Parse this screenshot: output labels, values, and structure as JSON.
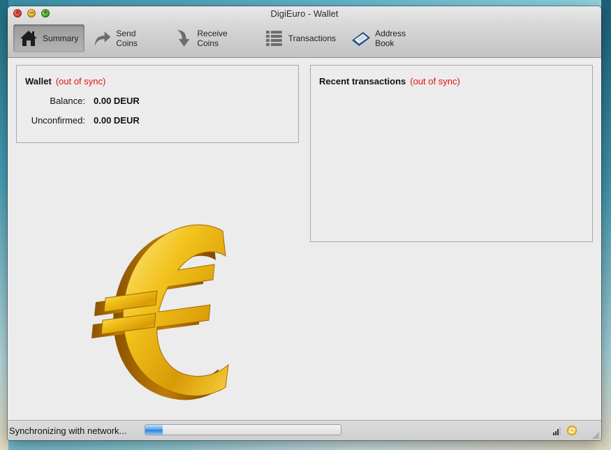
{
  "window": {
    "title": "DigiEuro - Wallet"
  },
  "toolbar": {
    "items": [
      {
        "label": "Summary",
        "icon": "home-icon",
        "active": true
      },
      {
        "label": "Send Coins",
        "icon": "send-arrow-icon"
      },
      {
        "label": "Receive Coins",
        "icon": "receive-arrow-icon"
      },
      {
        "label": "Transactions",
        "icon": "list-icon"
      },
      {
        "label": "Address Book",
        "icon": "address-book-icon"
      }
    ]
  },
  "wallet": {
    "title": "Wallet",
    "sync_status": "(out of sync)",
    "balance_label": "Balance:",
    "balance_value": "0.00 DEUR",
    "unconfirmed_label": "Unconfirmed:",
    "unconfirmed_value": "0.00 DEUR"
  },
  "recent": {
    "title": "Recent transactions",
    "sync_status": "(out of sync)"
  },
  "status": {
    "text": "Synchronizing with network...",
    "progress": 0.09
  },
  "colors": {
    "out_of_sync": "#e01010",
    "euro_gold": "#e8b010"
  }
}
